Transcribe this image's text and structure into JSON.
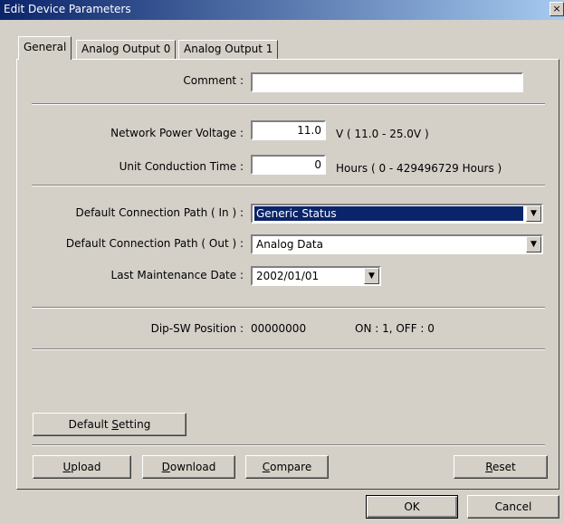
{
  "window": {
    "title": "Edit Device Parameters",
    "close_glyph": "×"
  },
  "tabs": [
    "General",
    "Analog Output 0",
    "Analog Output 1"
  ],
  "comment": {
    "label": "Comment :",
    "value": ""
  },
  "network_power": {
    "label": "Network Power Voltage :",
    "value": "11.0",
    "range": "V ( 11.0 - 25.0V )"
  },
  "unit_conduction": {
    "label": "Unit Conduction Time :",
    "value": "0",
    "range": "Hours ( 0 - 429496729 Hours )"
  },
  "path_in": {
    "label": "Default Connection Path ( In ) :",
    "value": "Generic Status"
  },
  "path_out": {
    "label": "Default Connection Path ( Out ) :",
    "value": "Analog Data"
  },
  "maintenance": {
    "label": "Last Maintenance Date :",
    "value": "2002/01/01"
  },
  "dipsw": {
    "label": "Dip-SW Position :",
    "value": "00000000",
    "legend": "ON : 1, OFF : 0"
  },
  "buttons": {
    "default_setting": {
      "pre": "Default ",
      "key": "S",
      "post": "etting"
    },
    "upload": {
      "pre": "",
      "key": "U",
      "post": "pload"
    },
    "download": {
      "pre": "",
      "key": "D",
      "post": "ownload"
    },
    "compare": {
      "pre": "",
      "key": "C",
      "post": "ompare"
    },
    "reset": {
      "pre": "",
      "key": "R",
      "post": "eset"
    },
    "ok": "OK",
    "cancel": "Cancel"
  },
  "icons": {
    "combo_arrow": "▼"
  }
}
